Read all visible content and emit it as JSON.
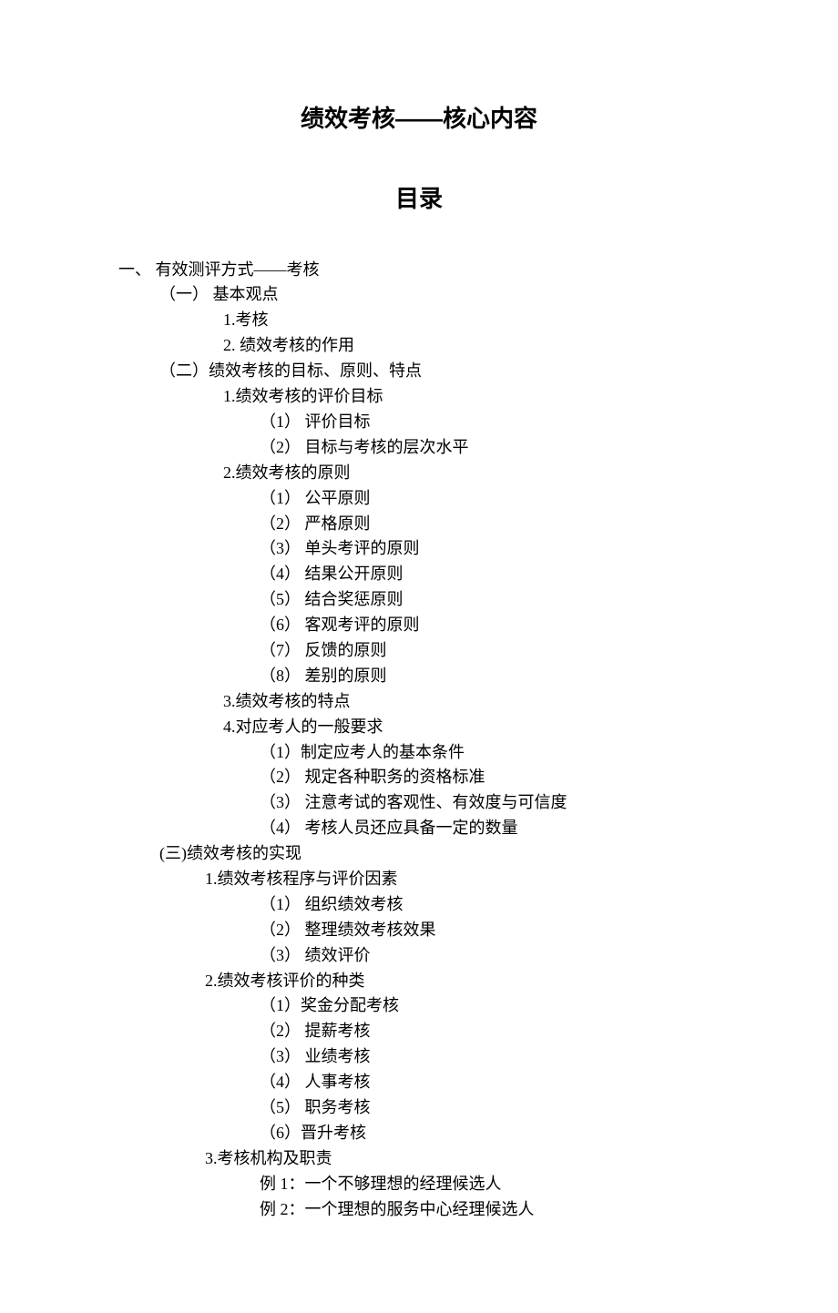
{
  "title": "绩效考核——核心内容",
  "tocTitle": "目录",
  "lines": [
    {
      "cls": "lvl1",
      "text": "一、 有效测评方式——考核"
    },
    {
      "cls": "lvl2",
      "text": "（一） 基本观点"
    },
    {
      "cls": "lvl3",
      "text": "1.考核"
    },
    {
      "cls": "lvl3",
      "text": "2. 绩效考核的作用"
    },
    {
      "cls": "lvl2",
      "text": "（二）绩效考核的目标、原则、特点"
    },
    {
      "cls": "lvl3",
      "text": "1.绩效考核的评价目标"
    },
    {
      "cls": "lvl4",
      "text": "（1） 评价目标"
    },
    {
      "cls": "lvl4",
      "text": "（2） 目标与考核的层次水平"
    },
    {
      "cls": "lvl3",
      "text": "2.绩效考核的原则"
    },
    {
      "cls": "lvl4",
      "text": "（1） 公平原则"
    },
    {
      "cls": "lvl4",
      "text": "（2） 严格原则"
    },
    {
      "cls": "lvl4",
      "text": "（3） 单头考评的原则"
    },
    {
      "cls": "lvl4",
      "text": "（4） 结果公开原则"
    },
    {
      "cls": "lvl4",
      "text": "（5） 结合奖惩原则"
    },
    {
      "cls": "lvl4",
      "text": "（6） 客观考评的原则"
    },
    {
      "cls": "lvl4",
      "text": "（7） 反馈的原则"
    },
    {
      "cls": "lvl4",
      "text": "（8） 差别的原则"
    },
    {
      "cls": "lvl3",
      "text": "3.绩效考核的特点"
    },
    {
      "cls": "lvl3",
      "text": "4.对应考人的一般要求"
    },
    {
      "cls": "lvl4",
      "text": "（1）制定应考人的基本条件"
    },
    {
      "cls": "lvl4",
      "text": "（2） 规定各种职务的资格标准"
    },
    {
      "cls": "lvl4",
      "text": "（3） 注意考试的客观性、有效度与可信度"
    },
    {
      "cls": "lvl4",
      "text": "（4） 考核人员还应具备一定的数量"
    },
    {
      "cls": "lvl2",
      "text": "(三)绩效考核的实现"
    },
    {
      "cls": "lvl3b",
      "text": "1.绩效考核程序与评价因素"
    },
    {
      "cls": "lvl4",
      "text": "（1） 组织绩效考核"
    },
    {
      "cls": "lvl4",
      "text": "（2） 整理绩效考核效果"
    },
    {
      "cls": "lvl4",
      "text": "（3） 绩效评价"
    },
    {
      "cls": "lvl3b",
      "text": "2.绩效考核评价的种类"
    },
    {
      "cls": "lvl4",
      "text": "（1）奖金分配考核"
    },
    {
      "cls": "lvl4",
      "text": "（2） 提薪考核"
    },
    {
      "cls": "lvl4",
      "text": "（3） 业绩考核"
    },
    {
      "cls": "lvl4",
      "text": "（4） 人事考核"
    },
    {
      "cls": "lvl4",
      "text": "（5） 职务考核"
    },
    {
      "cls": "lvl4",
      "text": "（6）晋升考核"
    },
    {
      "cls": "lvl3b",
      "text": "3.考核机构及职责"
    },
    {
      "cls": "lvl4",
      "text": "例 1：一个不够理想的经理候选人"
    },
    {
      "cls": "lvl4",
      "text": "例 2：一个理想的服务中心经理候选人"
    }
  ]
}
